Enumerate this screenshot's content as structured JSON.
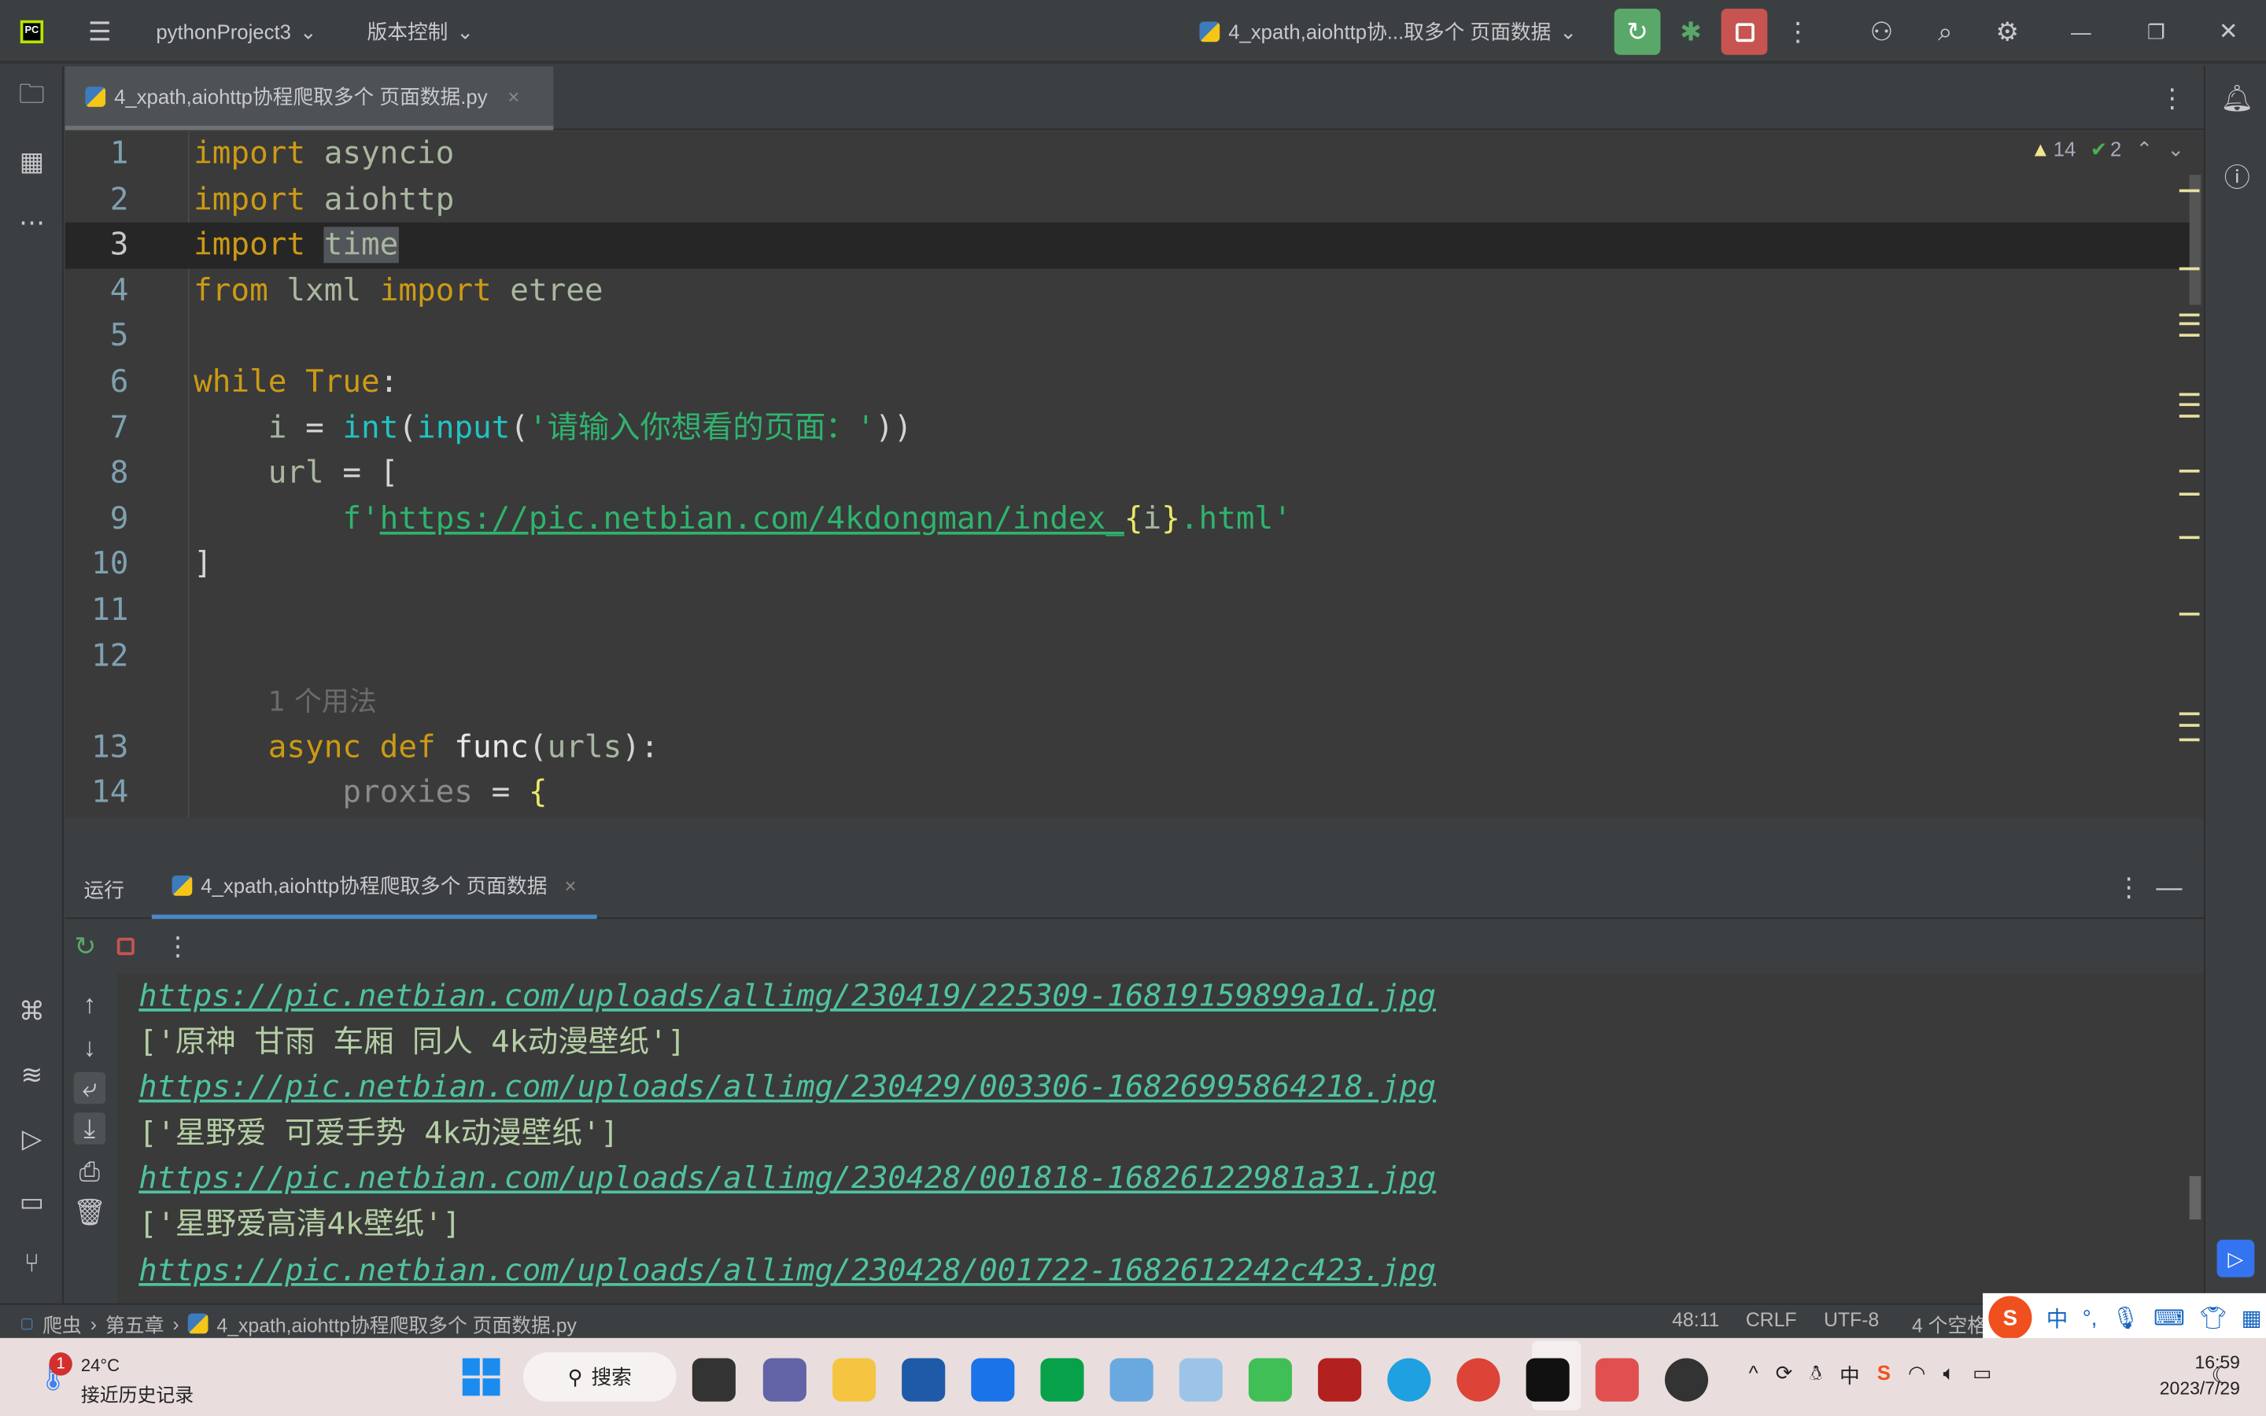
{
  "titlebar": {
    "project": "pythonProject3",
    "vcs": "版本控制",
    "run_config": "4_xpath,aiohttp协...取多个 页面数据"
  },
  "editor_tab": {
    "label": "4_xpath,aiohttp协程爬取多个 页面数据.py"
  },
  "inspections": {
    "warnings": "14",
    "weak_warnings": "2"
  },
  "code": [
    {
      "n": "1",
      "t": [
        [
          "kw",
          "import "
        ],
        [
          "id",
          "asyncio"
        ]
      ]
    },
    {
      "n": "2",
      "t": [
        [
          "kw",
          "import "
        ],
        [
          "id",
          "aiohttp"
        ]
      ]
    },
    {
      "n": "3",
      "cur": true,
      "t": [
        [
          "kw",
          "import "
        ],
        [
          "sel id",
          "time"
        ]
      ]
    },
    {
      "n": "4",
      "t": [
        [
          "kw",
          "from "
        ],
        [
          "id",
          "lxml "
        ],
        [
          "kw",
          "import "
        ],
        [
          "id",
          "etree"
        ]
      ]
    },
    {
      "n": "5",
      "t": []
    },
    {
      "n": "6",
      "t": [
        [
          "kw",
          "while "
        ],
        [
          "kw",
          "True"
        ],
        [
          "plain",
          ":"
        ]
      ]
    },
    {
      "n": "7",
      "t": [
        [
          "plain",
          "    "
        ],
        [
          "id",
          "i "
        ],
        [
          "plain",
          "= "
        ],
        [
          "fn",
          "int"
        ],
        [
          "plain",
          "("
        ],
        [
          "fn",
          "input"
        ],
        [
          "plain",
          "("
        ],
        [
          "str",
          "'请输入你想看的页面：'"
        ],
        [
          "plain",
          "))"
        ]
      ]
    },
    {
      "n": "8",
      "t": [
        [
          "plain",
          "    "
        ],
        [
          "id",
          "url "
        ],
        [
          "plain",
          "= ["
        ]
      ]
    },
    {
      "n": "9",
      "t": [
        [
          "plain",
          "        "
        ],
        [
          "str",
          "f'"
        ],
        [
          "url",
          "https://pic.netbian.com/4kdongman/index_"
        ],
        [
          "brace",
          "{"
        ],
        [
          "id",
          "i"
        ],
        [
          "brace",
          "}"
        ],
        [
          "str",
          ".html'"
        ]
      ]
    },
    {
      "n": "10",
      "t": [
        [
          "plain",
          "]"
        ]
      ]
    },
    {
      "n": "11",
      "t": []
    },
    {
      "n": "12",
      "t": []
    },
    {
      "n": "",
      "t": [
        [
          "plain",
          "    "
        ],
        [
          "hint",
          "1 个用法"
        ]
      ]
    },
    {
      "n": "13",
      "t": [
        [
          "plain",
          "    "
        ],
        [
          "kw",
          "async "
        ],
        [
          "kw",
          "def "
        ],
        [
          "white",
          "func"
        ],
        [
          "plain",
          "("
        ],
        [
          "id",
          "urls"
        ],
        [
          "plain",
          "):"
        ]
      ]
    },
    {
      "n": "14",
      "t": [
        [
          "plain",
          "        "
        ],
        [
          "dim",
          "proxies "
        ],
        [
          "plain",
          "= "
        ],
        [
          "brace",
          "{"
        ]
      ]
    }
  ],
  "run_panel": {
    "label": "运行",
    "tab": "4_xpath,aiohttp协程爬取多个 页面数据"
  },
  "console": [
    {
      "type": "link",
      "text": "https://pic.netbian.com/uploads/allimg/230419/225309-16819159899a1d.jpg"
    },
    {
      "type": "text",
      "text": "['原神 甘雨 车厢 同人 4k动漫壁纸']"
    },
    {
      "type": "link",
      "text": "https://pic.netbian.com/uploads/allimg/230429/003306-16826995864218.jpg"
    },
    {
      "type": "text",
      "text": "['星野爱 可爱手势 4k动漫壁纸']"
    },
    {
      "type": "link",
      "text": "https://pic.netbian.com/uploads/allimg/230428/001818-16826122981a31.jpg"
    },
    {
      "type": "text",
      "text": "['星野爱高清4k壁纸']"
    },
    {
      "type": "link",
      "text": "https://pic.netbian.com/uploads/allimg/230428/001722-1682612242c423.jpg"
    }
  ],
  "statusbar": {
    "crumbs": [
      "爬虫",
      "第五章",
      "4_xpath,aiohttp协程爬取多个 页面数据.py"
    ],
    "position": "48:11",
    "line_sep": "CRLF",
    "encoding": "UTF-8",
    "indent": "4 个空格"
  },
  "taskbar": {
    "weather_temp": "24°C",
    "weather_text": "接近历史记录",
    "weather_badge": "1",
    "search": "搜索",
    "ime": "中",
    "time": "16:59",
    "date": "2023/7/29"
  },
  "colors": {
    "run": "#59a869",
    "stop": "#c75450",
    "keyword": "#cc9a14",
    "string": "#2fb36e",
    "link": "#4fc3a1"
  }
}
